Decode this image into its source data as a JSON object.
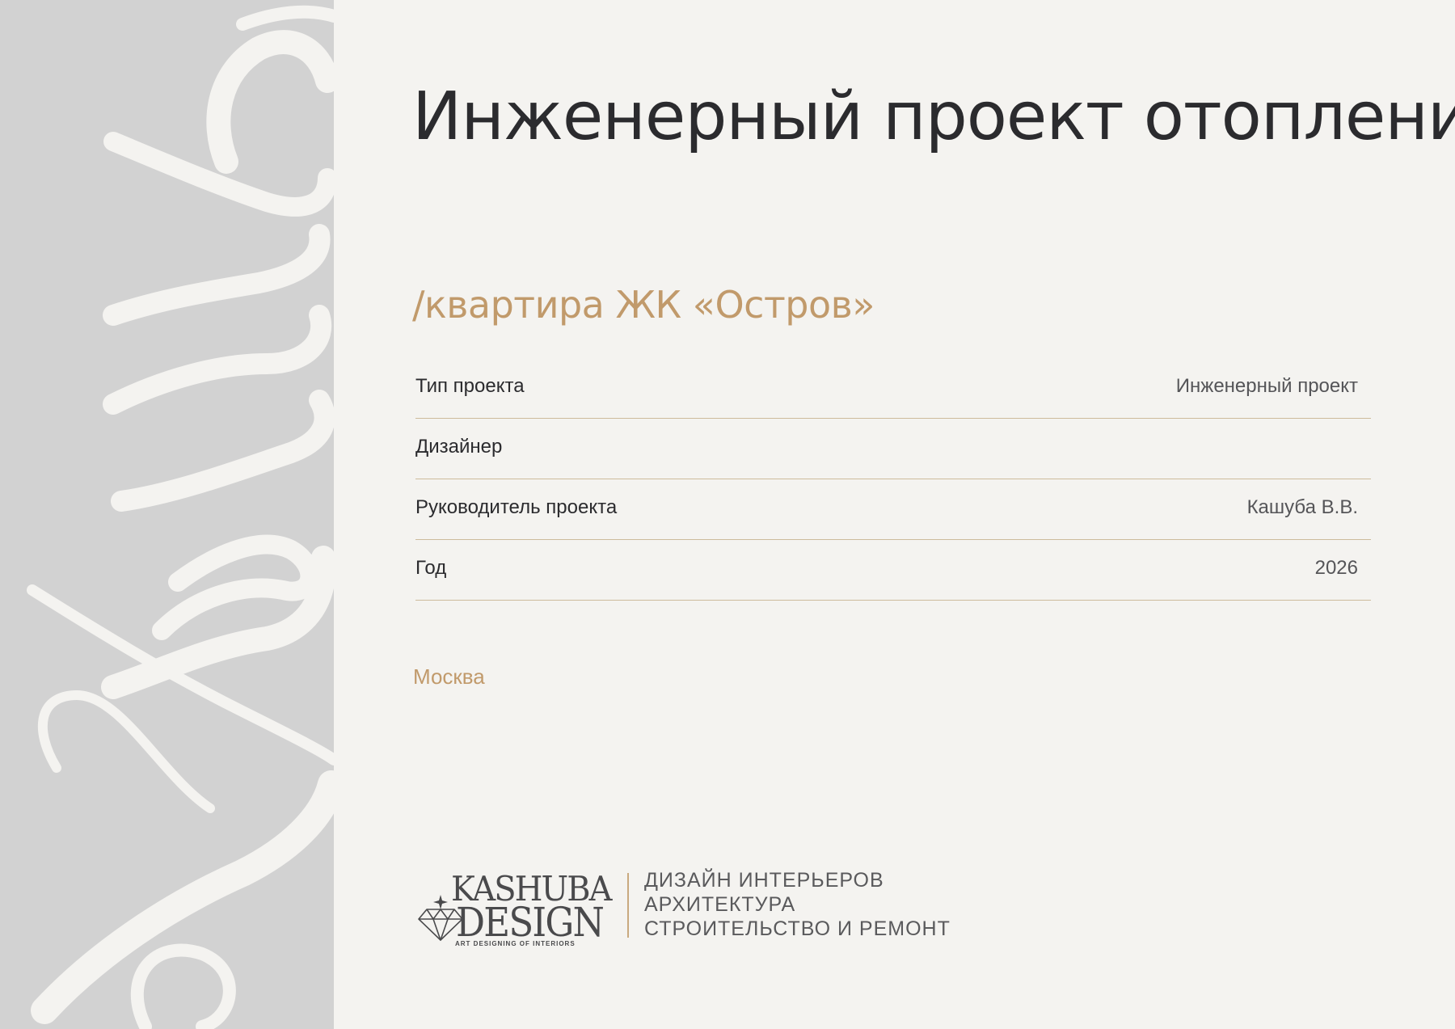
{
  "document": {
    "title": "Инженерный проект отопления",
    "subtitle": "/квартира ЖК «Остров»",
    "side_watermark": "Kashuba",
    "city": "Москва"
  },
  "info_rows": [
    {
      "label": "Тип проекта",
      "value": "Инженерный проект"
    },
    {
      "label": "Дизайнер",
      "value": ""
    },
    {
      "label": "Руководитель проекта",
      "value": "Кашуба В.В."
    },
    {
      "label": "Год",
      "value": "2026"
    }
  ],
  "logo": {
    "word1": "KASHUBA",
    "word2": "DESIGN",
    "tagline": "ART DESIGNING OF INTERIORS",
    "icon": "diamond-icon"
  },
  "services": [
    "ДИЗАЙН ИНТЕРЬЕРОВ",
    "АРХИТЕКТУРА",
    "СТРОИТЕЛЬСТВО И РЕМОНТ"
  ],
  "colors": {
    "background": "#f4f3f0",
    "side_band": "#d2d2d2",
    "accent": "#c19a6b",
    "text": "#2b2b2e",
    "rule": "#cdbb9c"
  }
}
